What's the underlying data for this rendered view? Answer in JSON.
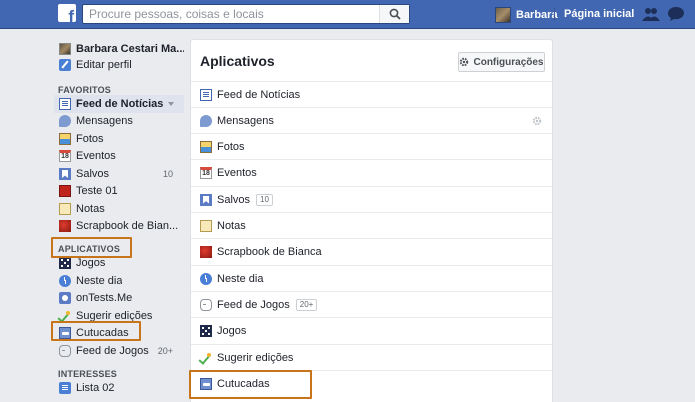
{
  "topbar": {
    "logo": "f",
    "search_placeholder": "Procure pessoas, coisas e locais",
    "user_name": "Barbara",
    "home_label": "Página inicial"
  },
  "sidebar": {
    "profile_name": "Barbara Cestari Ma...",
    "edit_profile": "Editar perfil",
    "favorites_header": "FAVORITOS",
    "favorites": [
      {
        "label": "Feed de Notícias",
        "icon": "news-feed-icon"
      },
      {
        "label": "Mensagens",
        "icon": "messages-icon"
      },
      {
        "label": "Fotos",
        "icon": "photos-icon"
      },
      {
        "label": "Eventos",
        "icon": "events-icon"
      },
      {
        "label": "Salvos",
        "icon": "saved-icon",
        "count": "10"
      },
      {
        "label": "Teste 01",
        "icon": "group-icon"
      },
      {
        "label": "Notas",
        "icon": "notes-icon"
      },
      {
        "label": "Scrapbook de Bian...",
        "icon": "scrapbook-icon"
      }
    ],
    "apps_header": "APLICATIVOS",
    "apps": [
      {
        "label": "Jogos",
        "icon": "games-icon"
      },
      {
        "label": "Neste dia",
        "icon": "on-this-day-icon"
      },
      {
        "label": "onTests.Me",
        "icon": "ontests-icon"
      },
      {
        "label": "Sugerir edições",
        "icon": "suggest-edits-icon"
      },
      {
        "label": "Cutucadas",
        "icon": "pokes-icon"
      },
      {
        "label": "Feed de Jogos",
        "icon": "games-feed-icon",
        "count": "20+"
      }
    ],
    "interests_header": "INTERESSES",
    "interests": [
      {
        "label": "Lista 02",
        "icon": "list-icon"
      }
    ]
  },
  "main": {
    "title": "Aplicativos",
    "settings_label": "Configurações",
    "apps": [
      {
        "label": "Feed de Notícias",
        "icon": "news-feed-icon"
      },
      {
        "label": "Mensagens",
        "icon": "messages-icon"
      },
      {
        "label": "Fotos",
        "icon": "photos-icon"
      },
      {
        "label": "Eventos",
        "icon": "events-icon"
      },
      {
        "label": "Salvos",
        "icon": "saved-icon",
        "badge": "10"
      },
      {
        "label": "Notas",
        "icon": "notes-icon"
      },
      {
        "label": "Scrapbook de Bianca",
        "icon": "scrapbook-icon"
      },
      {
        "label": "Neste dia",
        "icon": "on-this-day-icon"
      },
      {
        "label": "Feed de Jogos",
        "icon": "games-feed-icon",
        "badge": "20+"
      },
      {
        "label": "Jogos",
        "icon": "games-icon"
      },
      {
        "label": "Sugerir edições",
        "icon": "suggest-edits-icon"
      },
      {
        "label": "Cutucadas",
        "icon": "pokes-icon"
      }
    ],
    "events_icon_text": "18"
  },
  "colors": {
    "brand_blue": "#4267b2",
    "highlight_orange": "#c8741a"
  }
}
